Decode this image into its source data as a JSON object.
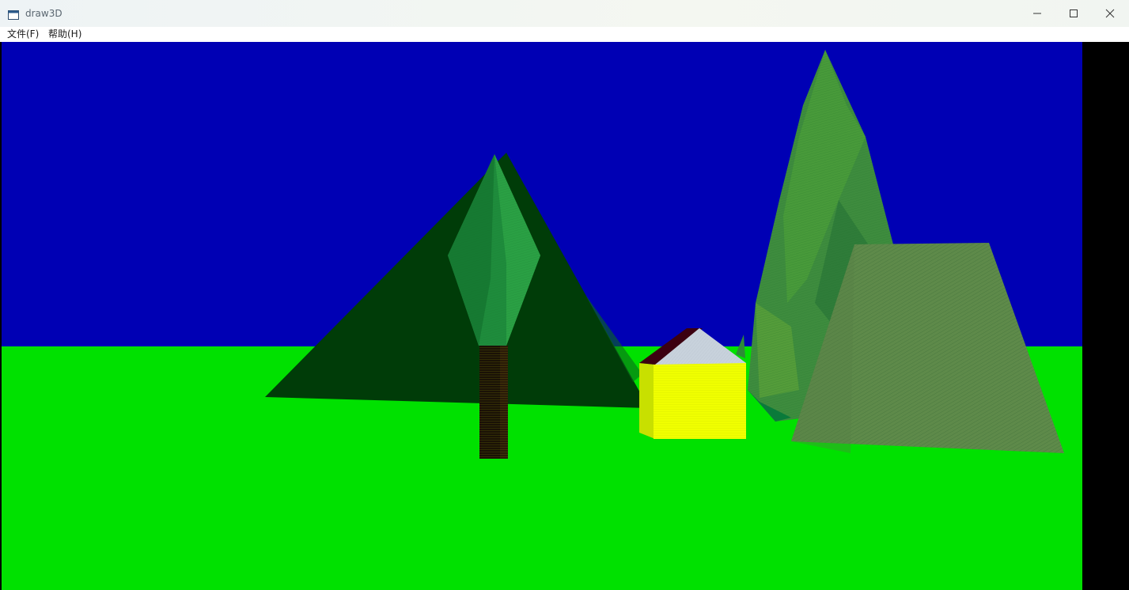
{
  "window": {
    "title": "draw3D",
    "icon": "app-window-icon",
    "controls": [
      "minimize-icon",
      "maximize-icon",
      "close-icon"
    ]
  },
  "menu": {
    "items": [
      {
        "label": "文件(F)"
      },
      {
        "label": "帮助(H)"
      }
    ]
  },
  "scene": {
    "colors": {
      "sky": "#0000b4",
      "ground": "#00e100",
      "side_panel": "#000000",
      "mountain": "#003c08",
      "tree_crown": "#1e8c3c",
      "tree_trunk": "#2a1a08",
      "house_wall": "#f0ff00",
      "house_wall_side": "#c8e000",
      "house_roof": "#c8d2dc",
      "house_roof_side": "#3c0010",
      "rock": "#5e8a4a",
      "tall_cone": "#3c8a3c"
    }
  }
}
